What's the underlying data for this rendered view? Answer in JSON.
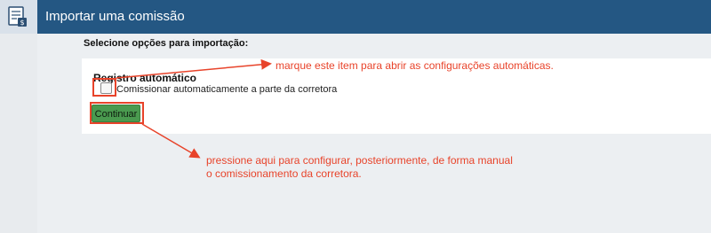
{
  "window": {
    "title": "Importar uma comissão",
    "app_icon": "document-money-icon"
  },
  "form": {
    "subheading": "Selecione opções para importação:",
    "section_title": "Registro automático",
    "checkbox_label": "Comissionar automaticamente a parte da corretora",
    "checkbox_checked": false,
    "continue_button": "Continuar"
  },
  "annotations": {
    "checkbox_note": "marque este item para abrir as configurações automáticas.",
    "button_note_line1": "pressione aqui para configurar, posteriormente, de forma manual",
    "button_note_line2": "o comissionamento da corretora.",
    "color": "#e8432a"
  },
  "colors": {
    "titlebar": "#245783",
    "button": "#4a9a4f"
  }
}
